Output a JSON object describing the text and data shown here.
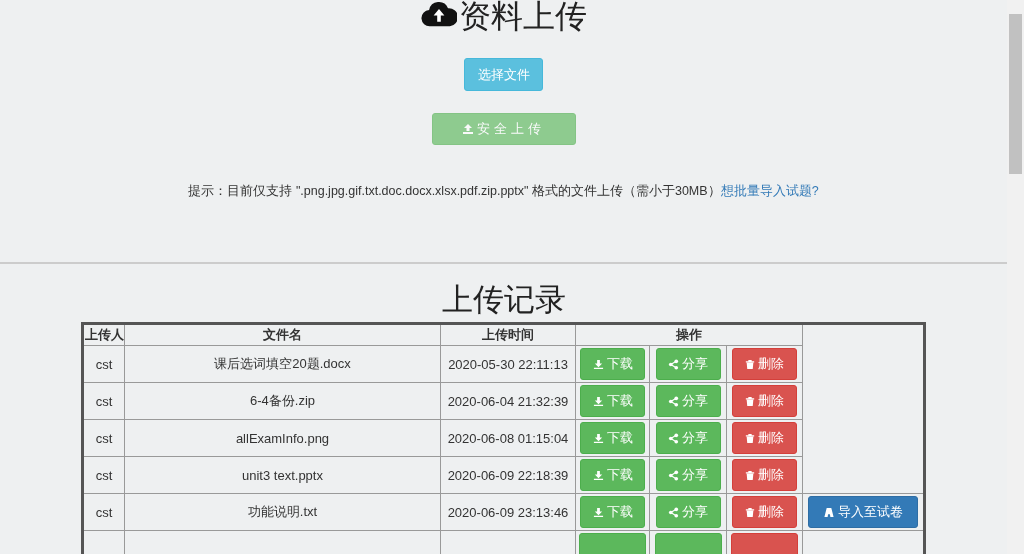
{
  "title": "资料上传",
  "choose_button": "选择文件",
  "upload_button": {
    "label": "安全上传",
    "disabled": true
  },
  "hint": {
    "text": "提示：目前仅支持 \".png.jpg.gif.txt.doc.docx.xlsx.pdf.zip.pptx\" 格式的文件上传（需小于30MB）",
    "link": "想批量导入试题?"
  },
  "records_title": "上传记录",
  "table": {
    "columns": [
      "上传人",
      "文件名",
      "上传时间",
      "操作"
    ],
    "rows": [
      {
        "kind": "full",
        "uploader": "cst",
        "file": "课后选词填空20题.docx",
        "time": "2020-05-30 22:11:13",
        "download": "下载",
        "share": "分享",
        "delete": "删除"
      },
      {
        "kind": "full",
        "uploader": "cst",
        "file": "6-4备份.zip",
        "time": "2020-06-04 21:32:39",
        "download": "下载",
        "share": "分享",
        "delete": "删除"
      },
      {
        "kind": "full",
        "uploader": "cst",
        "file": "allExamInfo.png",
        "time": "2020-06-08 01:15:04",
        "download": "下载",
        "share": "分享",
        "delete": "删除"
      },
      {
        "kind": "full",
        "uploader": "cst",
        "file": "unit3 text.pptx",
        "time": "2020-06-09 22:18:39",
        "download": "下载",
        "share": "分享",
        "delete": "删除"
      },
      {
        "kind": "full",
        "uploader": "cst",
        "file": "功能说明.txt",
        "time": "2020-06-09 23:13:46",
        "download": "下载",
        "share": "分享",
        "delete": "删除",
        "import": "导入至试卷"
      },
      {
        "kind": "cut"
      }
    ]
  }
}
